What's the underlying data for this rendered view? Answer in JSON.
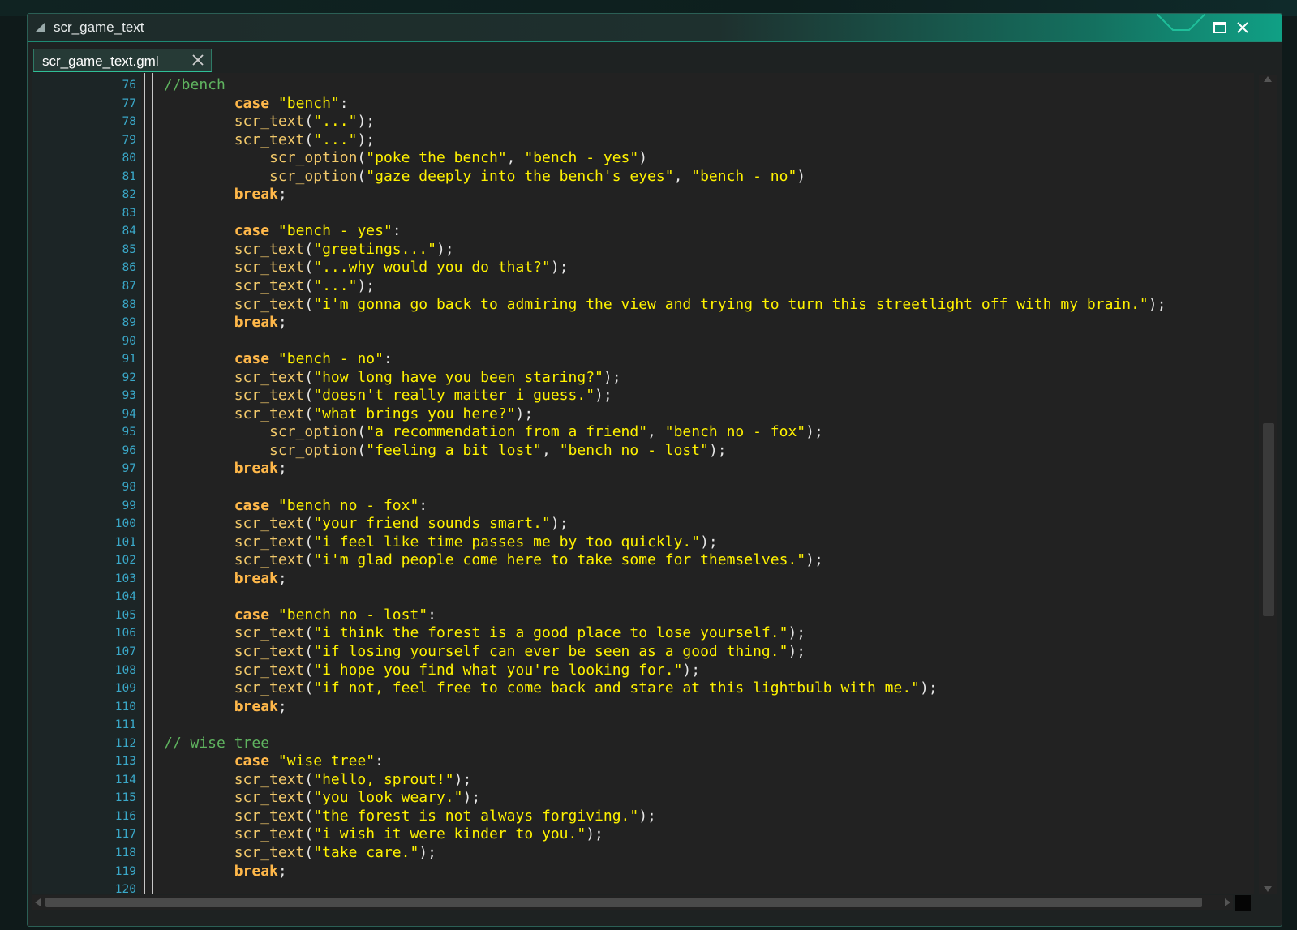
{
  "window": {
    "title": "scr_game_text"
  },
  "tab": {
    "label": "scr_game_text.gml"
  },
  "icons": {
    "grip": "resize-grip-icon",
    "maximize": "maximize-icon",
    "close": "close-icon",
    "tab_close": "tab-close-icon"
  },
  "colors": {
    "accent": "#10a085",
    "keyword": "#ffb84a",
    "string": "#fff200",
    "function": "#f2c96a",
    "comment": "#5fb35f",
    "line_number": "#3aa8c8"
  },
  "lines": [
    {
      "n": "76",
      "i": "",
      "t": [
        [
          "cm",
          "//bench"
        ]
      ]
    },
    {
      "n": "77",
      "i": "        ",
      "t": [
        [
          "kw",
          "case"
        ],
        [
          "p",
          " "
        ],
        [
          "str",
          "\"bench\""
        ],
        [
          "p",
          ":"
        ]
      ]
    },
    {
      "n": "78",
      "i": "        ",
      "t": [
        [
          "fn",
          "scr_text"
        ],
        [
          "p",
          "("
        ],
        [
          "str",
          "\"...\""
        ],
        [
          "p",
          ");"
        ]
      ]
    },
    {
      "n": "79",
      "i": "        ",
      "t": [
        [
          "fn",
          "scr_text"
        ],
        [
          "p",
          "("
        ],
        [
          "str",
          "\"...\""
        ],
        [
          "p",
          ");"
        ]
      ]
    },
    {
      "n": "80",
      "i": "            ",
      "t": [
        [
          "fn",
          "scr_option"
        ],
        [
          "p",
          "("
        ],
        [
          "str",
          "\"poke the bench\""
        ],
        [
          "p",
          ", "
        ],
        [
          "str",
          "\"bench - yes\""
        ],
        [
          "p",
          ")"
        ]
      ]
    },
    {
      "n": "81",
      "i": "            ",
      "t": [
        [
          "fn",
          "scr_option"
        ],
        [
          "p",
          "("
        ],
        [
          "str",
          "\"gaze deeply into the bench's eyes\""
        ],
        [
          "p",
          ", "
        ],
        [
          "str",
          "\"bench - no\""
        ],
        [
          "p",
          ")"
        ]
      ]
    },
    {
      "n": "82",
      "i": "        ",
      "t": [
        [
          "kw",
          "break"
        ],
        [
          "p",
          ";"
        ]
      ]
    },
    {
      "n": "83",
      "i": "",
      "t": []
    },
    {
      "n": "84",
      "i": "        ",
      "t": [
        [
          "kw",
          "case"
        ],
        [
          "p",
          " "
        ],
        [
          "str",
          "\"bench - yes\""
        ],
        [
          "p",
          ":"
        ]
      ]
    },
    {
      "n": "85",
      "i": "        ",
      "t": [
        [
          "fn",
          "scr_text"
        ],
        [
          "p",
          "("
        ],
        [
          "str",
          "\"greetings...\""
        ],
        [
          "p",
          ");"
        ]
      ]
    },
    {
      "n": "86",
      "i": "        ",
      "t": [
        [
          "fn",
          "scr_text"
        ],
        [
          "p",
          "("
        ],
        [
          "str",
          "\"...why would you do that?\""
        ],
        [
          "p",
          ");"
        ]
      ]
    },
    {
      "n": "87",
      "i": "        ",
      "t": [
        [
          "fn",
          "scr_text"
        ],
        [
          "p",
          "("
        ],
        [
          "str",
          "\"...\""
        ],
        [
          "p",
          ");"
        ]
      ]
    },
    {
      "n": "88",
      "i": "        ",
      "t": [
        [
          "fn",
          "scr_text"
        ],
        [
          "p",
          "("
        ],
        [
          "str",
          "\"i'm gonna go back to admiring the view and trying to turn this streetlight off with my brain.\""
        ],
        [
          "p",
          ");"
        ]
      ]
    },
    {
      "n": "89",
      "i": "        ",
      "t": [
        [
          "kw",
          "break"
        ],
        [
          "p",
          ";"
        ]
      ]
    },
    {
      "n": "90",
      "i": "",
      "t": []
    },
    {
      "n": "91",
      "i": "        ",
      "t": [
        [
          "kw",
          "case"
        ],
        [
          "p",
          " "
        ],
        [
          "str",
          "\"bench - no\""
        ],
        [
          "p",
          ":"
        ]
      ]
    },
    {
      "n": "92",
      "i": "        ",
      "t": [
        [
          "fn",
          "scr_text"
        ],
        [
          "p",
          "("
        ],
        [
          "str",
          "\"how long have you been staring?\""
        ],
        [
          "p",
          ");"
        ]
      ]
    },
    {
      "n": "93",
      "i": "        ",
      "t": [
        [
          "fn",
          "scr_text"
        ],
        [
          "p",
          "("
        ],
        [
          "str",
          "\"doesn't really matter i guess.\""
        ],
        [
          "p",
          ");"
        ]
      ]
    },
    {
      "n": "94",
      "i": "        ",
      "t": [
        [
          "fn",
          "scr_text"
        ],
        [
          "p",
          "("
        ],
        [
          "str",
          "\"what brings you here?\""
        ],
        [
          "p",
          ");"
        ]
      ]
    },
    {
      "n": "95",
      "i": "            ",
      "t": [
        [
          "fn",
          "scr_option"
        ],
        [
          "p",
          "("
        ],
        [
          "str",
          "\"a recommendation from a friend\""
        ],
        [
          "p",
          ", "
        ],
        [
          "str",
          "\"bench no - fox\""
        ],
        [
          "p",
          ");"
        ]
      ]
    },
    {
      "n": "96",
      "i": "            ",
      "t": [
        [
          "fn",
          "scr_option"
        ],
        [
          "p",
          "("
        ],
        [
          "str",
          "\"feeling a bit lost\""
        ],
        [
          "p",
          ", "
        ],
        [
          "str",
          "\"bench no - lost\""
        ],
        [
          "p",
          ");"
        ]
      ]
    },
    {
      "n": "97",
      "i": "        ",
      "t": [
        [
          "kw",
          "break"
        ],
        [
          "p",
          ";"
        ]
      ]
    },
    {
      "n": "98",
      "i": "",
      "t": []
    },
    {
      "n": "99",
      "i": "        ",
      "t": [
        [
          "kw",
          "case"
        ],
        [
          "p",
          " "
        ],
        [
          "str",
          "\"bench no - fox\""
        ],
        [
          "p",
          ":"
        ]
      ]
    },
    {
      "n": "100",
      "i": "        ",
      "t": [
        [
          "fn",
          "scr_text"
        ],
        [
          "p",
          "("
        ],
        [
          "str",
          "\"your friend sounds smart.\""
        ],
        [
          "p",
          ");"
        ]
      ]
    },
    {
      "n": "101",
      "i": "        ",
      "t": [
        [
          "fn",
          "scr_text"
        ],
        [
          "p",
          "("
        ],
        [
          "str",
          "\"i feel like time passes me by too quickly.\""
        ],
        [
          "p",
          ");"
        ]
      ]
    },
    {
      "n": "102",
      "i": "        ",
      "t": [
        [
          "fn",
          "scr_text"
        ],
        [
          "p",
          "("
        ],
        [
          "str",
          "\"i'm glad people come here to take some for themselves.\""
        ],
        [
          "p",
          ");"
        ]
      ]
    },
    {
      "n": "103",
      "i": "        ",
      "t": [
        [
          "kw",
          "break"
        ],
        [
          "p",
          ";"
        ]
      ]
    },
    {
      "n": "104",
      "i": "",
      "t": []
    },
    {
      "n": "105",
      "i": "        ",
      "t": [
        [
          "kw",
          "case"
        ],
        [
          "p",
          " "
        ],
        [
          "str",
          "\"bench no - lost\""
        ],
        [
          "p",
          ":"
        ]
      ]
    },
    {
      "n": "106",
      "i": "        ",
      "t": [
        [
          "fn",
          "scr_text"
        ],
        [
          "p",
          "("
        ],
        [
          "str",
          "\"i think the forest is a good place to lose yourself.\""
        ],
        [
          "p",
          ");"
        ]
      ]
    },
    {
      "n": "107",
      "i": "        ",
      "t": [
        [
          "fn",
          "scr_text"
        ],
        [
          "p",
          "("
        ],
        [
          "str",
          "\"if losing yourself can ever be seen as a good thing.\""
        ],
        [
          "p",
          ");"
        ]
      ]
    },
    {
      "n": "108",
      "i": "        ",
      "t": [
        [
          "fn",
          "scr_text"
        ],
        [
          "p",
          "("
        ],
        [
          "str",
          "\"i hope you find what you're looking for.\""
        ],
        [
          "p",
          ");"
        ]
      ]
    },
    {
      "n": "109",
      "i": "        ",
      "t": [
        [
          "fn",
          "scr_text"
        ],
        [
          "p",
          "("
        ],
        [
          "str",
          "\"if not, feel free to come back and stare at this lightbulb with me.\""
        ],
        [
          "p",
          ");"
        ]
      ]
    },
    {
      "n": "110",
      "i": "        ",
      "t": [
        [
          "kw",
          "break"
        ],
        [
          "p",
          ";"
        ]
      ]
    },
    {
      "n": "111",
      "i": "",
      "t": []
    },
    {
      "n": "112",
      "i": "",
      "t": [
        [
          "cm",
          "// wise tree"
        ]
      ]
    },
    {
      "n": "113",
      "i": "        ",
      "t": [
        [
          "kw",
          "case"
        ],
        [
          "p",
          " "
        ],
        [
          "str",
          "\"wise tree\""
        ],
        [
          "p",
          ":"
        ]
      ]
    },
    {
      "n": "114",
      "i": "        ",
      "t": [
        [
          "fn",
          "scr_text"
        ],
        [
          "p",
          "("
        ],
        [
          "str",
          "\"hello, sprout!\""
        ],
        [
          "p",
          ");"
        ]
      ]
    },
    {
      "n": "115",
      "i": "        ",
      "t": [
        [
          "fn",
          "scr_text"
        ],
        [
          "p",
          "("
        ],
        [
          "str",
          "\"you look weary.\""
        ],
        [
          "p",
          ");"
        ]
      ]
    },
    {
      "n": "116",
      "i": "        ",
      "t": [
        [
          "fn",
          "scr_text"
        ],
        [
          "p",
          "("
        ],
        [
          "str",
          "\"the forest is not always forgiving.\""
        ],
        [
          "p",
          ");"
        ]
      ]
    },
    {
      "n": "117",
      "i": "        ",
      "t": [
        [
          "fn",
          "scr_text"
        ],
        [
          "p",
          "("
        ],
        [
          "str",
          "\"i wish it were kinder to you.\""
        ],
        [
          "p",
          ");"
        ]
      ]
    },
    {
      "n": "118",
      "i": "        ",
      "t": [
        [
          "fn",
          "scr_text"
        ],
        [
          "p",
          "("
        ],
        [
          "str",
          "\"take care.\""
        ],
        [
          "p",
          ");"
        ]
      ]
    },
    {
      "n": "119",
      "i": "        ",
      "t": [
        [
          "kw",
          "break"
        ],
        [
          "p",
          ";"
        ]
      ]
    },
    {
      "n": "120",
      "i": "",
      "t": []
    }
  ]
}
